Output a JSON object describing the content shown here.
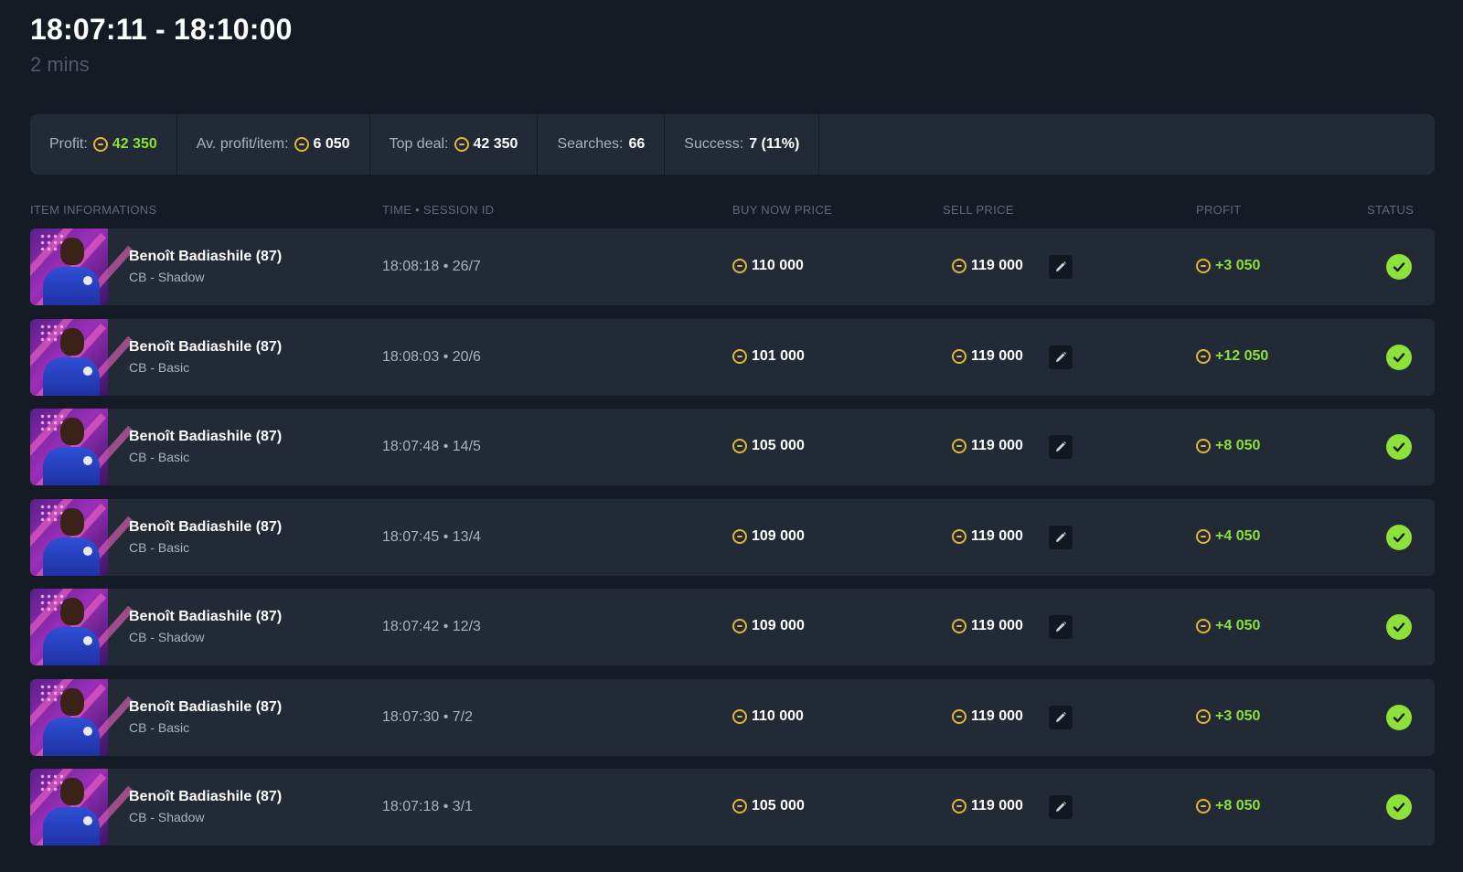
{
  "session": {
    "time_range": "18:07:11 - 18:10:00",
    "duration": "2 mins"
  },
  "stats": {
    "profit_label": "Profit:",
    "profit_value": "42 350",
    "avg_label": "Av. profit/item:",
    "avg_value": "6 050",
    "top_deal_label": "Top deal:",
    "top_deal_value": "42 350",
    "searches_label": "Searches:",
    "searches_value": "66",
    "success_label": "Success:",
    "success_value": "7 (11%)"
  },
  "columns": {
    "item": "ITEM INFORMATIONS",
    "time": "TIME • SESSION ID",
    "buy": "BUY NOW PRICE",
    "sell": "SELL PRICE",
    "profit": "PROFIT",
    "status": "STATUS"
  },
  "rows": [
    {
      "name": "Benoît Badiashile (87)",
      "sub": "CB - Shadow",
      "time_session": "18:08:18 • 26/7",
      "buy": "110 000",
      "sell": "119 000",
      "profit": "+3 050"
    },
    {
      "name": "Benoît Badiashile (87)",
      "sub": "CB - Basic",
      "time_session": "18:08:03 • 20/6",
      "buy": "101 000",
      "sell": "119 000",
      "profit": "+12 050"
    },
    {
      "name": "Benoît Badiashile (87)",
      "sub": "CB - Basic",
      "time_session": "18:07:48 • 14/5",
      "buy": "105 000",
      "sell": "119 000",
      "profit": "+8 050"
    },
    {
      "name": "Benoît Badiashile (87)",
      "sub": "CB - Basic",
      "time_session": "18:07:45 • 13/4",
      "buy": "109 000",
      "sell": "119 000",
      "profit": "+4 050"
    },
    {
      "name": "Benoît Badiashile (87)",
      "sub": "CB - Shadow",
      "time_session": "18:07:42 • 12/3",
      "buy": "109 000",
      "sell": "119 000",
      "profit": "+4 050"
    },
    {
      "name": "Benoît Badiashile (87)",
      "sub": "CB - Basic",
      "time_session": "18:07:30 • 7/2",
      "buy": "110 000",
      "sell": "119 000",
      "profit": "+3 050"
    },
    {
      "name": "Benoît Badiashile (87)",
      "sub": "CB - Shadow",
      "time_session": "18:07:18 • 3/1",
      "buy": "105 000",
      "sell": "119 000",
      "profit": "+8 050"
    }
  ],
  "colors": {
    "background": "#151b24",
    "panel": "#212a35",
    "profit_green": "#8ee03a",
    "coin_gold": "#e2b53a"
  },
  "icons": {
    "coin": "coin-icon",
    "edit": "pencil-icon",
    "status": "check-circle-icon"
  }
}
